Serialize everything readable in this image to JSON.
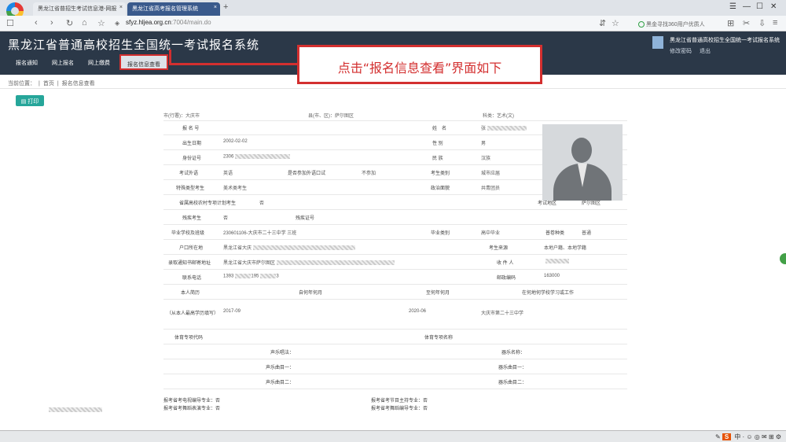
{
  "browser": {
    "tab1": "黑龙江省普招生考试信息港-网报",
    "tab2": "黑龙江省高考报名管理系统",
    "url_host": "sfyz.hljea.org.cn",
    "url_path": ":7004/main.do",
    "search": "黑金寻找360用户优质人"
  },
  "app": {
    "title": "黑龙江省普通高校招生全国统一考试报名系统",
    "user_line": "黑龙江省普通高校招生全国统一考试报名系统",
    "link_change_pwd": "修改密码",
    "link_logout": "退出",
    "tabs": [
      "报名通知",
      "网上报名",
      "网上缴费",
      "报名信息查看"
    ]
  },
  "callout": "点击“报名信息查看”界面如下",
  "breadcrumb": {
    "prefix": "当前位置：",
    "home": "首页",
    "current": "报名信息查看"
  },
  "print_label": "打印",
  "region": {
    "city": "市(行署)：大庆市",
    "county": "县(市、区)：萨尔图区",
    "subject": "科类：艺术(文)"
  },
  "form": {
    "reg_no": "报 名 号",
    "name_label": "姓　名",
    "name_value": "张",
    "birth_label": "出生日期",
    "birth_value": "2002-02-02",
    "gender_label": "性 别",
    "gender_value": "男",
    "id_label": "身份证号",
    "id_value": "2306",
    "nation_label": "民 族",
    "nation_value": "汉族",
    "lang_label": "考试外语",
    "lang_value": "英语",
    "oral_label": "是否参加外语口试",
    "oral_value": "不参加",
    "category_label": "考生类别",
    "category_value": "城市应届",
    "special_label": "特殊类型考生",
    "special_value": "美术类考生",
    "political_label": "政治面貌",
    "political_value": "共青团员",
    "rural_label": "省属高校农村专项计划考生",
    "rural_value": "否",
    "area_label": "考试地区",
    "area_value": "萨尔图区",
    "disabled_label": "残疾考生",
    "disabled_value": "否",
    "disabled_cert_label": "残疾证号",
    "school_label": "毕业学校及班级",
    "school_value": "230601106-大庆市二十三中学 三班",
    "grad_label": "毕业类别",
    "grad_value": "高中毕业",
    "grad_type_label": "普卷种类",
    "grad_type_value": "普通",
    "hukou_label": "户口所在地",
    "hukou_value": "黑龙江省大庆",
    "source_label": "考生来源",
    "source_value": "本地户籍、本地学籍",
    "mail_label": "录取通知书邮寄地址",
    "mail_value": "黑龙江省大庆市萨尔图区",
    "receiver_label": "收 件 人",
    "phone_label": "联系电话",
    "phone_value": "1393",
    "phone_value2": "195",
    "phone_value3": "3",
    "zip_label": "邮政编码",
    "zip_value": "163000",
    "resume_label": "本人简历",
    "resume_sub": "（从本人最高学历填写）",
    "from_label": "自何年何月",
    "to_label": "至何年何月",
    "where_label": "在何地何学校学习或工作",
    "from_value": "2017-09",
    "to_value": "2020-06",
    "where_value": "大庆市第二十三中学",
    "sport_code_label": "体育专项代码",
    "sport_name_label": "体育专项名称",
    "vocal_label": "声乐唱法：",
    "instrument_label": "器乐名称：",
    "song1_label": "声乐曲目一：",
    "inst1_label": "器乐曲目一：",
    "song2_label": "声乐曲目二：",
    "inst2_label": "器乐曲目二：",
    "film_label": "报考省考电视编导专业：否",
    "host_label": "报考省考节目主持专业：否",
    "dance_label": "报考省考舞蹈表演专业：否",
    "dance_edit_label": "报考省考舞蹈编导专业：否"
  }
}
